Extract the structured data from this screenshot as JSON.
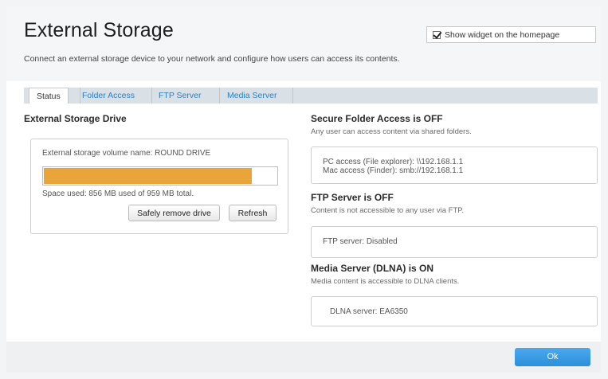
{
  "header": {
    "title": "External Storage",
    "subtitle": "Connect an external storage device to your network and configure how users can access its contents.",
    "widget_label": "Show widget on the homepage",
    "widget_checked": true
  },
  "tabs": [
    {
      "label": "Status",
      "active": true
    },
    {
      "label": "Folder Access",
      "active": false
    },
    {
      "label": "FTP Server",
      "active": false
    },
    {
      "label": "Media Server",
      "active": false
    }
  ],
  "drive": {
    "heading": "External Storage Drive",
    "volume_name": "External storage volume name: ROUND DRIVE",
    "usage_fraction": 0.893,
    "usage_color": "#e9a43a",
    "space_used": "Space used: 856 MB used of 959 MB total.",
    "safely_remove_label": "Safely remove drive",
    "refresh_label": "Refresh"
  },
  "secure_folder": {
    "heading": "Secure Folder Access is OFF",
    "description": "Any user can access content via shared folders.",
    "pc_access": "PC access (File explorer): \\\\192.168.1.1",
    "mac_access": "Mac access (Finder): smb://192.168.1.1"
  },
  "ftp": {
    "heading": "FTP Server is OFF",
    "description": "Content is not accessible to any user via FTP.",
    "status": "FTP server: Disabled"
  },
  "media": {
    "heading": "Media Server (DLNA) is ON",
    "description": "Media content is accessible to DLNA clients.",
    "status": "DLNA server: EA6350"
  },
  "footer": {
    "ok_label": "Ok"
  },
  "colors": {
    "accent": "#2f7fc3",
    "ok_button": "#3a9ae5"
  }
}
